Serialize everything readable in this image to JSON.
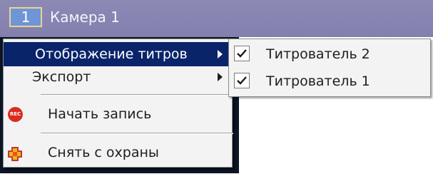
{
  "camera": {
    "number": "1",
    "title": "Камера 1"
  },
  "menu": {
    "items": [
      {
        "label": "Отображение титров",
        "has_submenu": true,
        "selected": true
      },
      {
        "label": "Экспорт",
        "has_submenu": true,
        "selected": false
      },
      {
        "label": "Начать запись",
        "icon": "record-icon",
        "icon_text": "REC"
      },
      {
        "label": "Снять с охраны",
        "icon": "disarm-icon"
      }
    ]
  },
  "submenu": {
    "items": [
      {
        "label": "Титрователь 2",
        "checked": true
      },
      {
        "label": "Титрователь 1",
        "checked": true
      }
    ]
  },
  "colors": {
    "header": "#8380ae",
    "menu_selection": "#0a246a",
    "menu_background": "#f3f3f3",
    "record": "#d92c1f"
  }
}
